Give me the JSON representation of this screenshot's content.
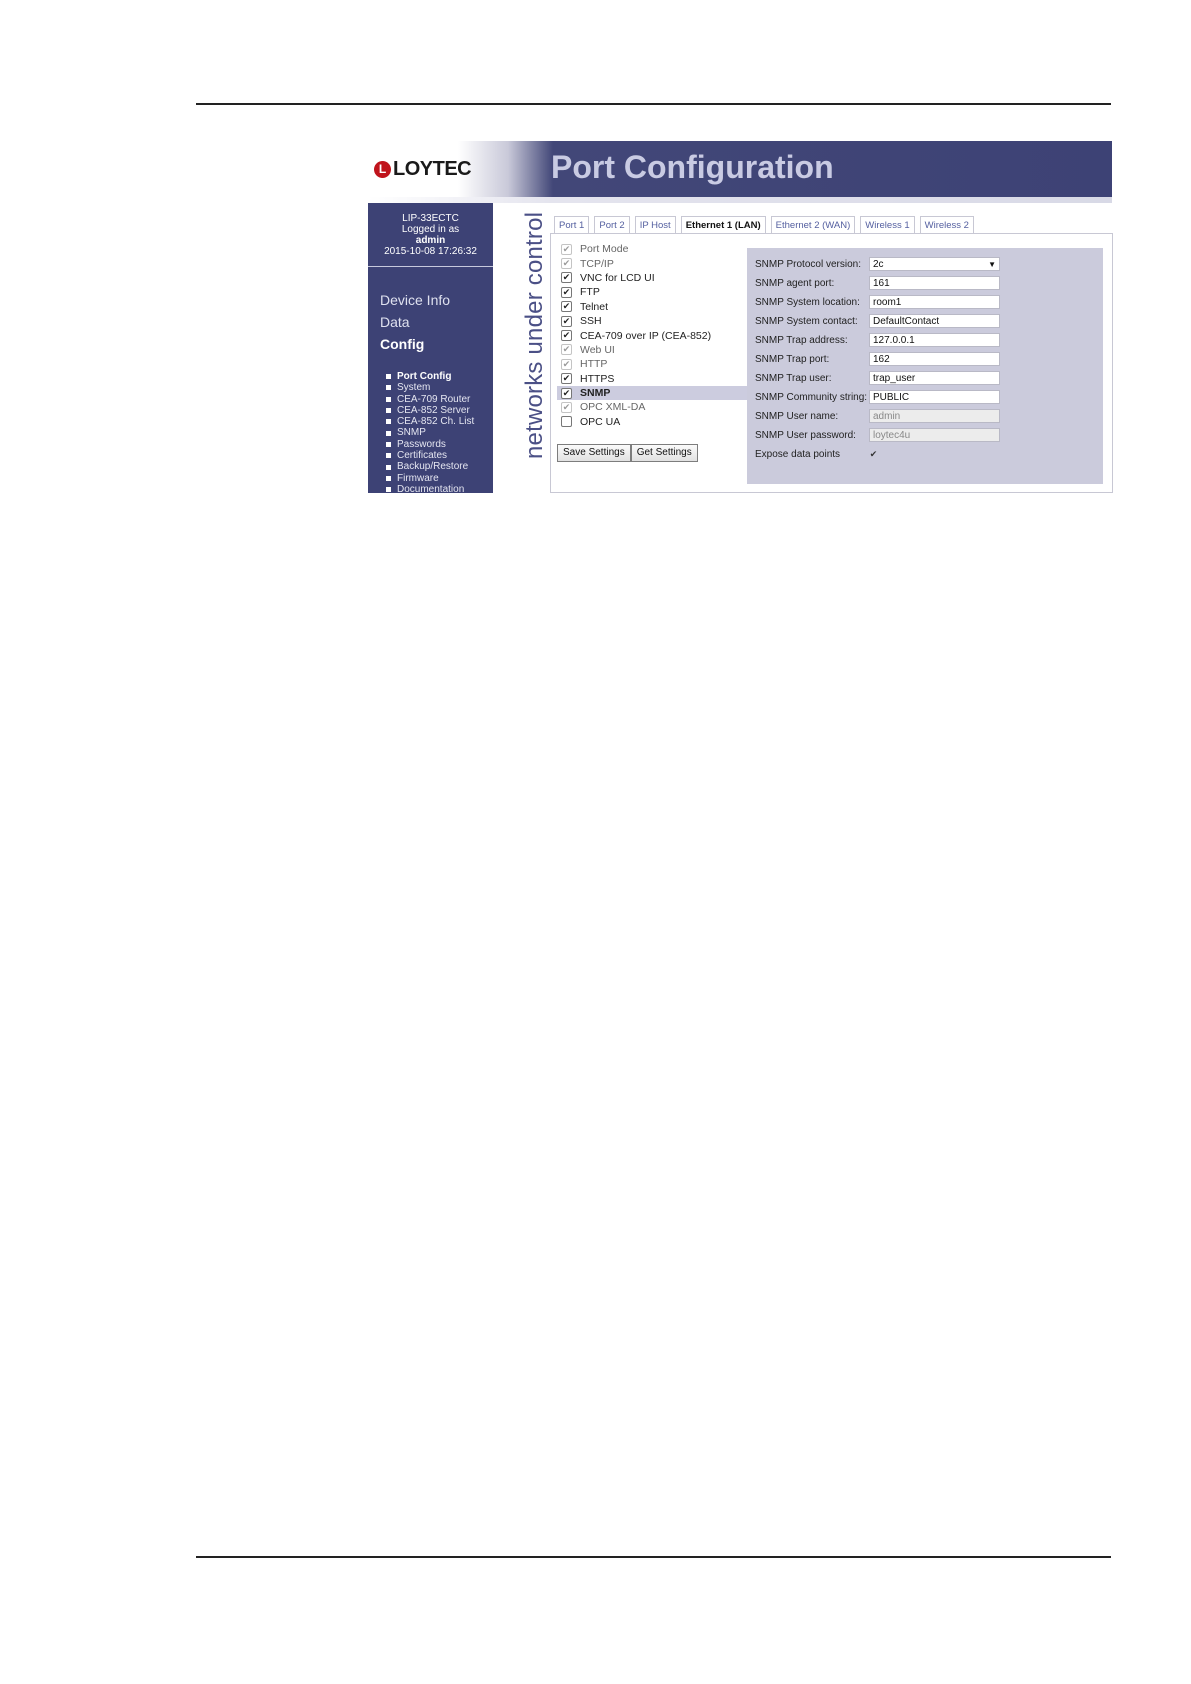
{
  "app": {
    "brand_mark": "L",
    "brand": "LOYTEC",
    "title": "Port Configuration",
    "tagline": "networks under control"
  },
  "device": {
    "model": "LIP-33ECTC",
    "login_text": "Logged in as",
    "user": "admin",
    "datetime": "2015-10-08 17:26:32"
  },
  "nav": {
    "main": [
      {
        "label": "Device Info",
        "active": false
      },
      {
        "label": "Data",
        "active": false
      },
      {
        "label": "Config",
        "active": true
      }
    ],
    "sub": [
      {
        "label": "Port Config",
        "active": true
      },
      {
        "label": "System",
        "active": false
      },
      {
        "label": "CEA-709 Router",
        "active": false
      },
      {
        "label": "CEA-852 Server",
        "active": false
      },
      {
        "label": "CEA-852 Ch. List",
        "active": false
      },
      {
        "label": "SNMP",
        "active": false
      },
      {
        "label": "Passwords",
        "active": false
      },
      {
        "label": "Certificates",
        "active": false
      },
      {
        "label": "Backup/Restore",
        "active": false
      },
      {
        "label": "Firmware",
        "active": false
      },
      {
        "label": "Documentation",
        "active": false
      }
    ]
  },
  "tabs": [
    {
      "label": "Port 1",
      "active": false
    },
    {
      "label": "Port 2",
      "active": false
    },
    {
      "label": "IP Host",
      "active": false
    },
    {
      "label": "Ethernet 1 (LAN)",
      "active": true
    },
    {
      "label": "Ethernet 2 (WAN)",
      "active": false
    },
    {
      "label": "Wireless 1",
      "active": false
    },
    {
      "label": "Wireless 2",
      "active": false
    }
  ],
  "services": [
    {
      "label": "Port Mode",
      "checked": true,
      "disabled": true
    },
    {
      "label": "TCP/IP",
      "checked": true,
      "disabled": true
    },
    {
      "label": "VNC for LCD UI",
      "checked": true,
      "disabled": false
    },
    {
      "label": "FTP",
      "checked": true,
      "disabled": false
    },
    {
      "label": "Telnet",
      "checked": true,
      "disabled": false
    },
    {
      "label": "SSH",
      "checked": true,
      "disabled": false
    },
    {
      "label": "CEA-709 over IP (CEA-852)",
      "checked": true,
      "disabled": false
    },
    {
      "label": "Web UI",
      "checked": true,
      "disabled": true
    },
    {
      "label": "HTTP",
      "checked": true,
      "disabled": true
    },
    {
      "label": "HTTPS",
      "checked": true,
      "disabled": false
    },
    {
      "label": "SNMP",
      "checked": true,
      "disabled": false,
      "selected": true
    },
    {
      "label": "OPC XML-DA",
      "checked": true,
      "disabled": true
    },
    {
      "label": "OPC UA",
      "checked": false,
      "disabled": false
    }
  ],
  "snmp": {
    "protocol_version_label": "SNMP Protocol version:",
    "protocol_version_value": "2c",
    "agent_port_label": "SNMP agent port:",
    "agent_port_value": "161",
    "system_location_label": "SNMP System location:",
    "system_location_value": "room1",
    "system_contact_label": "SNMP System contact:",
    "system_contact_value": "DefaultContact",
    "trap_address_label": "SNMP Trap address:",
    "trap_address_value": "127.0.0.1",
    "trap_port_label": "SNMP Trap port:",
    "trap_port_value": "162",
    "trap_user_label": "SNMP Trap user:",
    "trap_user_value": "trap_user",
    "community_label": "SNMP Community string:",
    "community_value": "PUBLIC",
    "user_name_label": "SNMP User name:",
    "user_name_value": "admin",
    "user_password_label": "SNMP User password:",
    "user_password_value": "loytec4u",
    "expose_label": "Expose data points",
    "expose_checked": true
  },
  "buttons": {
    "save": "Save Settings",
    "get": "Get Settings"
  },
  "glyphs": {
    "check": "✔",
    "dropdown_arrow": "▼",
    "bullet": "■"
  }
}
